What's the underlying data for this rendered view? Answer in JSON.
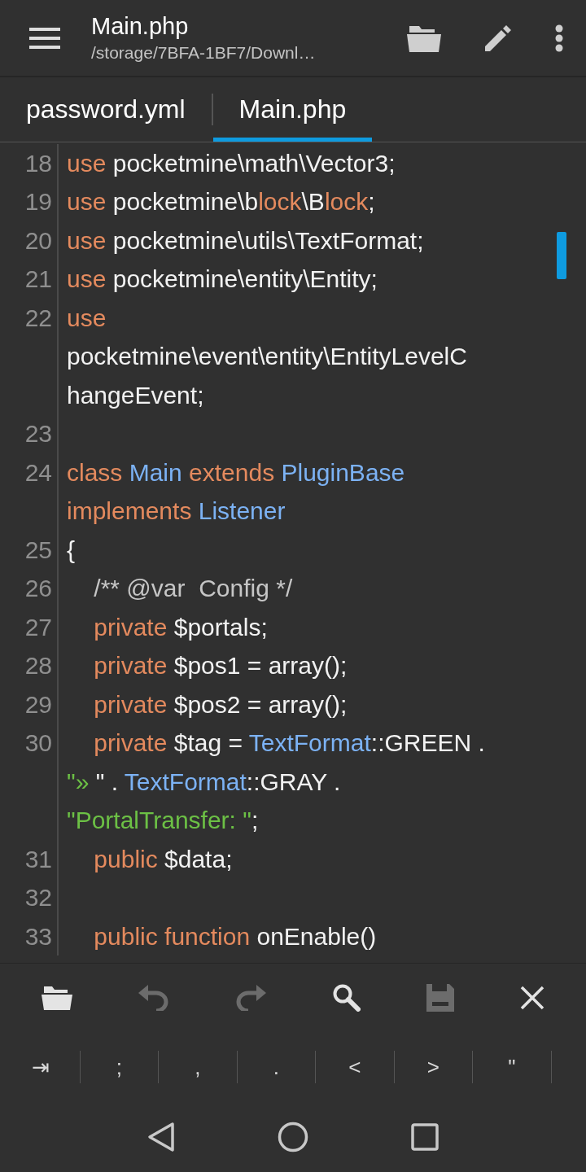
{
  "app_bar": {
    "title": "Main.php",
    "subtitle": "/storage/7BFA-1BF7/Downl…"
  },
  "tabs": [
    {
      "label": "password.yml",
      "selected": false
    },
    {
      "label": "Main.php",
      "selected": true
    }
  ],
  "editor": {
    "lines": [
      {
        "number": "18",
        "wrapped_lines": [
          {
            "spans": [
              {
                "kind": "kw",
                "text": "use"
              },
              {
                "kind": "plain",
                "text": " pocketmine\\math\\Vector3;"
              }
            ]
          }
        ]
      },
      {
        "number": "19",
        "wrapped_lines": [
          {
            "spans": [
              {
                "kind": "kw",
                "text": "use"
              },
              {
                "kind": "plain",
                "text": " pocketmine\\b"
              },
              {
                "kind": "kw",
                "text": "lock"
              },
              {
                "kind": "plain",
                "text": "\\B"
              },
              {
                "kind": "kw",
                "text": "lock"
              },
              {
                "kind": "plain",
                "text": ";"
              }
            ]
          }
        ]
      },
      {
        "number": "20",
        "wrapped_lines": [
          {
            "spans": [
              {
                "kind": "kw",
                "text": "use"
              },
              {
                "kind": "plain",
                "text": " pocketmine\\utils\\TextFormat;"
              }
            ]
          }
        ]
      },
      {
        "number": "21",
        "wrapped_lines": [
          {
            "spans": [
              {
                "kind": "kw",
                "text": "use"
              },
              {
                "kind": "plain",
                "text": " pocketmine\\entity\\Entity;"
              }
            ]
          }
        ]
      },
      {
        "number": "22",
        "wrapped_lines": [
          {
            "spans": [
              {
                "kind": "kw",
                "text": "use"
              }
            ]
          },
          {
            "spans": [
              {
                "kind": "plain",
                "text": "pocketmine\\event\\entity\\EntityLevelC"
              }
            ]
          },
          {
            "spans": [
              {
                "kind": "plain",
                "text": "hangeEvent;"
              }
            ]
          }
        ]
      },
      {
        "number": "23"
      },
      {
        "number": "24",
        "wrapped_lines": [
          {
            "spans": [
              {
                "kind": "kw",
                "text": "class"
              },
              {
                "kind": "type",
                "text": " Main"
              },
              {
                "kind": "kw",
                "text": " extends"
              },
              {
                "kind": "type",
                "text": " PluginBase"
              }
            ]
          },
          {
            "spans": [
              {
                "kind": "kw",
                "text": "implements"
              },
              {
                "kind": "type",
                "text": " Listener"
              }
            ]
          }
        ]
      },
      {
        "number": "25",
        "wrapped_lines": [
          {
            "spans": [
              {
                "kind": "plain",
                "text": "{"
              }
            ]
          }
        ]
      },
      {
        "number": "26",
        "wrapped_lines": [
          {
            "spans": [
              {
                "kind": "comment",
                "text": "    /** @var  Config */"
              }
            ]
          }
        ]
      },
      {
        "number": "27",
        "wrapped_lines": [
          {
            "spans": [
              {
                "kind": "kw",
                "text": "    private"
              },
              {
                "kind": "plain",
                "text": " $portals;"
              }
            ]
          }
        ]
      },
      {
        "number": "28",
        "wrapped_lines": [
          {
            "spans": [
              {
                "kind": "kw",
                "text": "    private"
              },
              {
                "kind": "plain",
                "text": " $pos1 = array();"
              }
            ]
          }
        ]
      },
      {
        "number": "29",
        "wrapped_lines": [
          {
            "spans": [
              {
                "kind": "kw",
                "text": "    private"
              },
              {
                "kind": "plain",
                "text": " $pos2 = array();"
              }
            ]
          }
        ]
      },
      {
        "number": "30",
        "wrapped_lines": [
          {
            "spans": [
              {
                "kind": "kw",
                "text": "    private"
              },
              {
                "kind": "plain",
                "text": " $tag = "
              },
              {
                "kind": "type",
                "text": "TextFormat"
              },
              {
                "kind": "plain",
                "text": "::GREEN ."
              }
            ]
          },
          {
            "spans": [
              {
                "kind": "str",
                "text": "\"» "
              },
              {
                "kind": "plain",
                "text": "\" . "
              },
              {
                "kind": "type",
                "text": "TextFormat"
              },
              {
                "kind": "plain",
                "text": "::GRAY ."
              }
            ]
          },
          {
            "spans": [
              {
                "kind": "str",
                "text": "\"PortalTransfer: \""
              },
              {
                "kind": "plain",
                "text": ";"
              }
            ]
          }
        ]
      },
      {
        "number": "31",
        "wrapped_lines": [
          {
            "spans": [
              {
                "kind": "kw",
                "text": "    public"
              },
              {
                "kind": "plain",
                "text": " $data;"
              }
            ]
          }
        ]
      },
      {
        "number": "32"
      },
      {
        "number": "33",
        "wrapped_lines": [
          {
            "spans": [
              {
                "kind": "kw",
                "text": "    public function"
              },
              {
                "kind": "plain",
                "text": " onEnable()"
              }
            ]
          }
        ]
      }
    ]
  },
  "toolbar": [
    {
      "kind": "open",
      "disabled": false
    },
    {
      "kind": "undo",
      "disabled": true
    },
    {
      "kind": "redo",
      "disabled": true
    },
    {
      "kind": "search",
      "disabled": false
    },
    {
      "kind": "save",
      "disabled": true
    },
    {
      "kind": "close",
      "disabled": false
    }
  ],
  "symbol_keys": [
    "⇥",
    ";",
    ",",
    ".",
    "<",
    ">",
    "\""
  ]
}
